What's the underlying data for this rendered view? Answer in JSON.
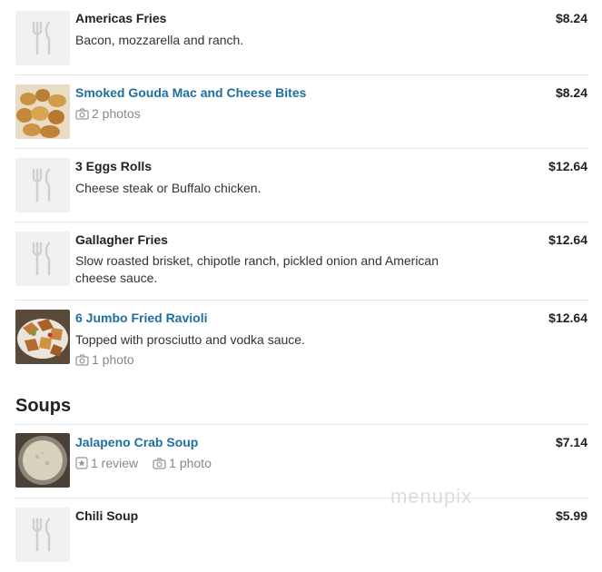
{
  "menu": {
    "items": [
      {
        "name": "Americas Fries",
        "description": "Bacon, mozzarella and ranch.",
        "price": "$8.24",
        "image": "placeholder"
      },
      {
        "name": "Smoked Gouda Mac and Cheese Bites",
        "photos": "2 photos",
        "price": "$8.24",
        "image": "photo"
      },
      {
        "name": "3 Eggs Rolls",
        "description": "Cheese steak or Buffalo chicken.",
        "price": "$12.64",
        "image": "placeholder"
      },
      {
        "name": "Gallagher Fries",
        "description": "Slow roasted brisket, chipotle ranch, pickled onion and American cheese sauce.",
        "price": "$12.64",
        "image": "placeholder"
      },
      {
        "name": "6 Jumbo Fried Ravioli",
        "description": "Topped with prosciutto and vodka sauce.",
        "photos": "1 photo",
        "price": "$12.64",
        "image": "photo"
      }
    ]
  },
  "soups": {
    "heading": "Soups",
    "items": [
      {
        "name": "Jalapeno Crab Soup",
        "reviews": "1 review",
        "photos": "1 photo",
        "price": "$7.14",
        "image": "photo"
      },
      {
        "name": "Chili Soup",
        "price": "$5.99",
        "image": "placeholder"
      }
    ]
  },
  "watermark": "menupix",
  "icons": {
    "placeholder": "fork-knife-icon",
    "photos": "camera-icon",
    "reviews": "star-icon"
  },
  "colors": {
    "link": "#1f6f9e",
    "muted": "#888888",
    "separator": "#e4e4e4"
  }
}
